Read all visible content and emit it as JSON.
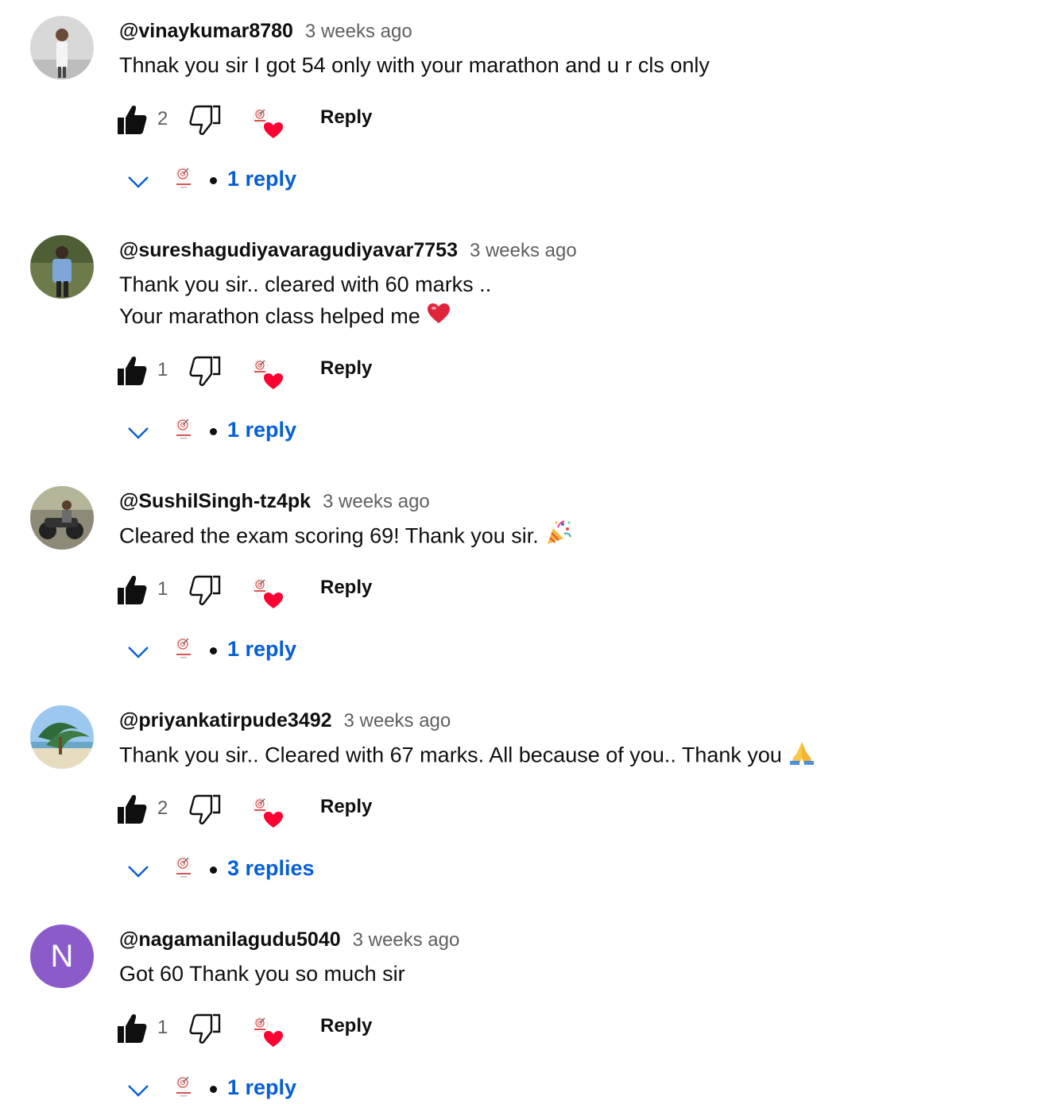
{
  "icons": {
    "like": "thumbs-up-icon",
    "dislike": "thumbs-down-icon",
    "creator_heart": "creator-heart-icon",
    "expand": "chevron-down-icon",
    "creator_avatar": "channel-logo-icon"
  },
  "colors": {
    "link": "#065fd4",
    "meta": "#606060",
    "heart": "#ff0033",
    "avatar_letter_bg": "#8b5cc9"
  },
  "comments": [
    {
      "author": "@vinaykumar8780",
      "time": "3 weeks ago",
      "lines": [
        "Thnak you sir I got 54 only with your marathon and u r cls only"
      ],
      "emoji": "",
      "likes": "2",
      "reply_label": "Reply",
      "replies_label": "1 reply",
      "avatar": "photo-person"
    },
    {
      "author": "@sureshagudiyavaragudiyavar7753",
      "time": "3 weeks ago",
      "lines": [
        "Thank you sir.. cleared with 60 marks ..",
        "Your marathon class helped me"
      ],
      "emoji": "red-heart",
      "likes": "1",
      "reply_label": "Reply",
      "replies_label": "1 reply",
      "avatar": "photo-person-outdoor"
    },
    {
      "author": "@SushilSingh-tz4pk",
      "time": "3 weeks ago",
      "lines": [
        "Cleared the exam scoring 69! Thank you sir."
      ],
      "emoji": "party-popper",
      "likes": "1",
      "reply_label": "Reply",
      "replies_label": "1 reply",
      "avatar": "photo-motorbike"
    },
    {
      "author": "@priyankatirpude3492",
      "time": "3 weeks ago",
      "lines": [
        "Thank you sir.. Cleared with 67 marks. All because of you.. Thank you"
      ],
      "emoji": "folded-hands",
      "likes": "2",
      "reply_label": "Reply",
      "replies_label": "3 replies",
      "avatar": "photo-beach-palm"
    },
    {
      "author": "@nagamanilagudu5040",
      "time": "3 weeks ago",
      "lines": [
        "Got 60 Thank you so much sir"
      ],
      "emoji": "",
      "likes": "1",
      "reply_label": "Reply",
      "replies_label": "1 reply",
      "avatar": "letter",
      "avatar_letter": "N"
    }
  ]
}
